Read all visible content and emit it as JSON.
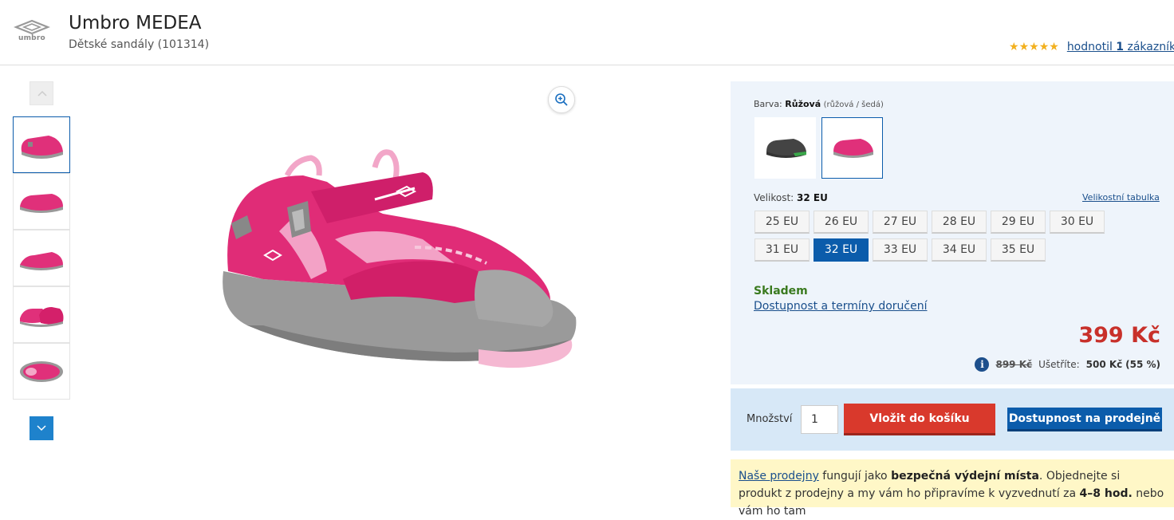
{
  "header": {
    "brand_logo_text": "umbro",
    "title": "Umbro MEDEA",
    "subtitle": "Dětské sandály (101314)",
    "rating": {
      "stars": 5,
      "link_prefix": "hodnotil ",
      "count": "1",
      "link_suffix": " zákazník"
    }
  },
  "gallery": {
    "thumbnails": [
      "sandal-side",
      "sandal-side-2",
      "sandal-side-3",
      "sandal-pair",
      "sandal-top"
    ],
    "active_thumbnail": 0,
    "main_image": "pink-sandal"
  },
  "icons": {
    "up": "chevron-up-icon",
    "down": "chevron-down-icon",
    "zoom": "zoom-in-icon",
    "info": "info-icon",
    "star": "star-icon"
  },
  "product": {
    "color": {
      "label": "Barva:",
      "value": "Růžová",
      "detail": "(růžová / šedá)",
      "swatches": [
        "černá",
        "růžová"
      ]
    },
    "size": {
      "label": "Velikost:",
      "value": "32 EU",
      "table_link": "Velikostní tabulka",
      "options": [
        "25 EU",
        "26 EU",
        "27 EU",
        "28 EU",
        "29 EU",
        "30 EU",
        "31 EU",
        "32 EU",
        "33 EU",
        "34 EU",
        "35 EU"
      ],
      "selected_index": 7
    },
    "stock": "Skladem",
    "delivery_link": "Dostupnost a termíny doručení",
    "price": "399 Kč",
    "old_price": "899 Kč",
    "savings_label": "Ušetříte:",
    "savings_value": "500 Kč",
    "savings_percent": "(55 %)"
  },
  "cart": {
    "qty_label": "Množství",
    "qty_value": "1",
    "add_label": "Vložit do košíku",
    "stores_label": "Dostupnost na prodejně"
  },
  "notice": {
    "link": "Naše prodejny",
    "text1": " fungují jako ",
    "bold1": "bezpečná výdejní místa",
    "text2": ". Objednejte si produkt z prodejny a my vám ho připravíme k vyzvednutí za ",
    "bold2": "4–8 hod.",
    "text3": " nebo vám ho tam"
  },
  "colors": {
    "accent_blue": "#0b5cab",
    "price_red": "#c8302a",
    "stock_green": "#3a7a1f",
    "add_button_red": "#d9392c",
    "star_gold": "#f2b01e",
    "panel_bg": "#eef4fb",
    "notice_bg": "#fff7c7"
  }
}
